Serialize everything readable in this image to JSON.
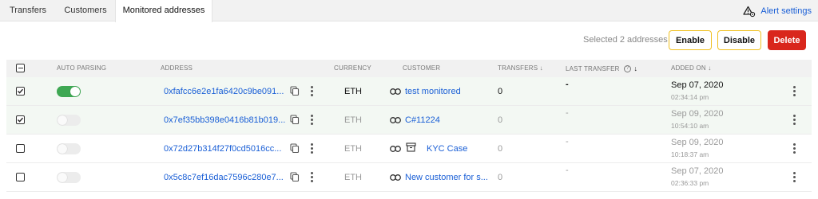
{
  "tabs": [
    {
      "label": "Transfers"
    },
    {
      "label": "Customers"
    },
    {
      "label": "Monitored addresses",
      "active": true
    }
  ],
  "alert_settings_label": "Alert settings",
  "selection_text": "Selected 2 addresses",
  "actions": {
    "enable": "Enable",
    "disable": "Disable",
    "delete": "Delete"
  },
  "colors": {
    "accent": "#1a5fd6",
    "toggle_on": "#3ea853",
    "delete": "#d9261c",
    "outline": "#f0c020"
  },
  "columns": {
    "auto_parsing": "AUTO PARSING",
    "address": "ADDRESS",
    "currency": "CURRENCY",
    "customer": "CUSTOMER",
    "transfers": "TRANSFERS ↓",
    "last_transfer": "LAST TRANSFER",
    "added_on": "ADDED ON ↓"
  },
  "rows": [
    {
      "checked": true,
      "auto_parsing": true,
      "address": "0xfafcc6e2e1fa6420c9be091...",
      "currency": "ETH",
      "customer": "test monitored",
      "transfers": "0",
      "last_transfer": "-",
      "date": "Sep 07, 2020",
      "time": "02:34:14 pm"
    },
    {
      "checked": true,
      "auto_parsing": false,
      "address": "0x7ef35bb398e0416b81b019...",
      "currency": "ETH",
      "customer": "C#11224",
      "transfers": "0",
      "last_transfer": "-",
      "date": "Sep 09, 2020",
      "time": "10:54:10 am"
    },
    {
      "checked": false,
      "auto_parsing": false,
      "address": "0x72d27b314f27f0cd5016cc...",
      "currency": "ETH",
      "customer": "KYC Case",
      "customer_case_icon": true,
      "transfers": "0",
      "last_transfer": "-",
      "date": "Sep 09, 2020",
      "time": "10:18:37 am"
    },
    {
      "checked": false,
      "auto_parsing": false,
      "address": "0x5c8c7ef16dac7596c280e7...",
      "currency": "ETH",
      "customer": "New customer for s...",
      "transfers": "0",
      "last_transfer": "-",
      "date": "Sep 07, 2020",
      "time": "02:36:33 pm"
    }
  ]
}
